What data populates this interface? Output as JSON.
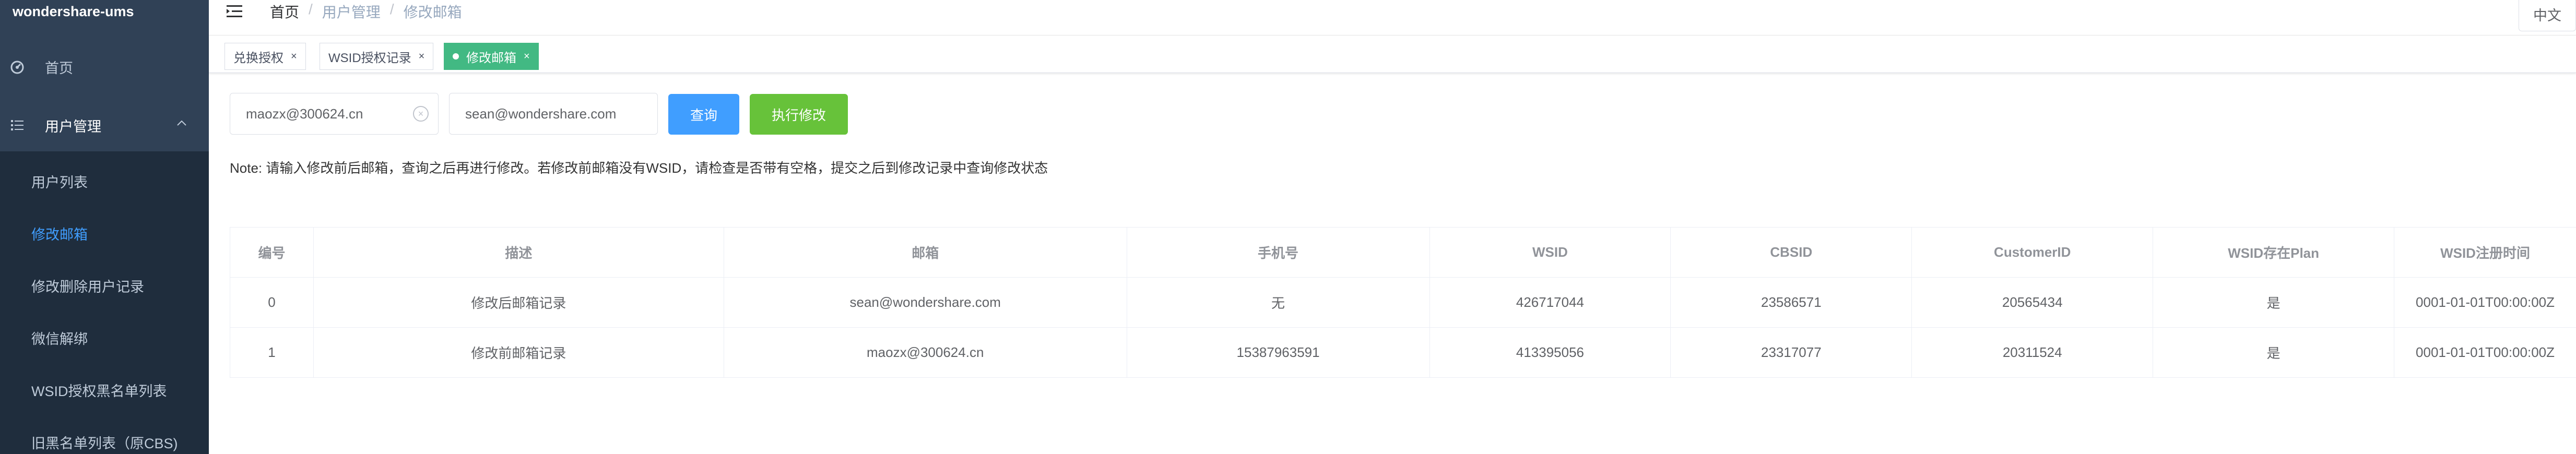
{
  "app": {
    "brand": "wondershare-ums"
  },
  "sidebar": {
    "home_label": "首页",
    "group_label": "用户管理",
    "items": [
      {
        "label": "用户列表",
        "active": false
      },
      {
        "label": "修改邮箱",
        "active": true
      },
      {
        "label": "修改删除用户记录",
        "active": false
      },
      {
        "label": "微信解绑",
        "active": false
      },
      {
        "label": "WSID授权黑名单列表",
        "active": false
      },
      {
        "label": "旧黑名单列表（原CBS)",
        "active": false
      }
    ]
  },
  "breadcrumb": {
    "home": "首页",
    "section": "用户管理",
    "current": "修改邮箱",
    "sep": "/"
  },
  "lang_label": "中文",
  "tags": [
    {
      "label": "兑换授权",
      "active": false
    },
    {
      "label": "WSID授权记录",
      "active": false
    },
    {
      "label": "修改邮箱",
      "active": true
    }
  ],
  "form": {
    "old_email": "maozx@300624.cn",
    "new_email": "sean@wondershare.com",
    "query_label": "查询",
    "execute_label": "执行修改"
  },
  "note": "Note: 请输入修改前后邮箱，查询之后再进行修改。若修改前邮箱没有WSID，请检查是否带有空格，提交之后到修改记录中查询修改状态",
  "table": {
    "columns": [
      "编号",
      "描述",
      "邮箱",
      "手机号",
      "WSID",
      "CBSID",
      "CustomerID",
      "WSID存在Plan",
      "WSID注册时间"
    ],
    "rows": [
      [
        "0",
        "修改后邮箱记录",
        "sean@wondershare.com",
        "无",
        "426717044",
        "23586571",
        "20565434",
        "是",
        "0001-01-01T00:00:00Z"
      ],
      [
        "1",
        "修改前邮箱记录",
        "maozx@300624.cn",
        "15387963591",
        "413395056",
        "23317077",
        "20311524",
        "是",
        "0001-01-01T00:00:00Z"
      ]
    ]
  },
  "colors": {
    "sidebar_bg": "#304156",
    "submenu_bg": "#1f2d3d",
    "active_link": "#409eff",
    "tag_active": "#42b983",
    "query_btn": "#409eff",
    "execute_btn": "#67c23a"
  }
}
